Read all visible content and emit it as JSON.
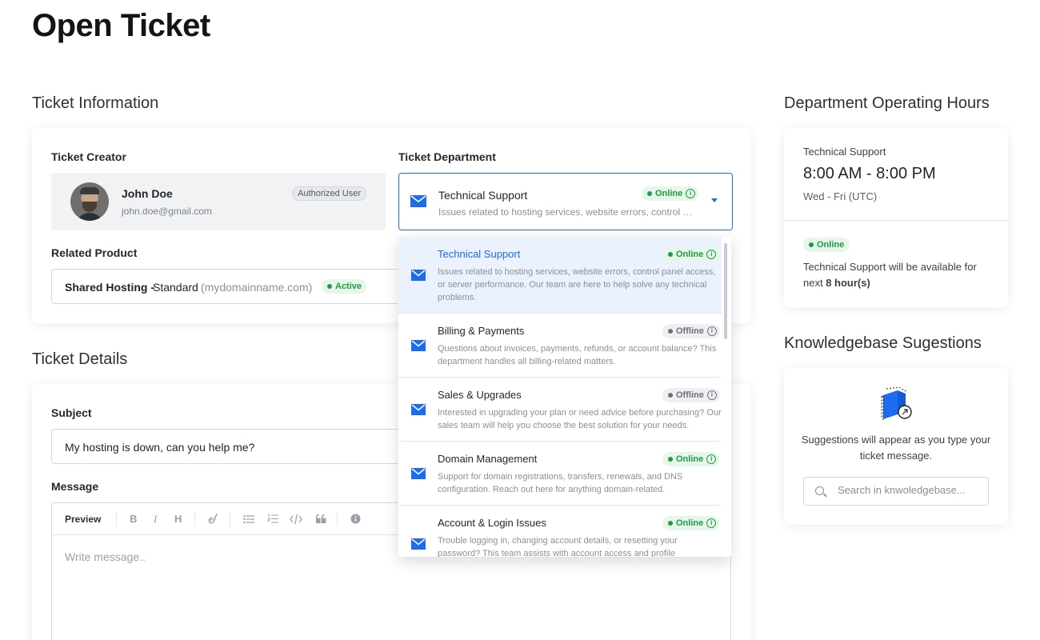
{
  "page": {
    "title": "Open Ticket"
  },
  "sections": {
    "ticket_information": "Ticket Information",
    "ticket_details": "Ticket Details",
    "operating_hours": "Department Operating Hours",
    "kb_suggestions": "Knowledgebase Sugestions"
  },
  "ticket_info": {
    "creator_label": "Ticket Creator",
    "creator_name": "John Doe",
    "creator_email": "john.doe@gmail.com",
    "creator_badge": "Authorized User",
    "department_label": "Ticket Department",
    "selected_department": {
      "name": "Technical Support",
      "status": "Online",
      "description": "Issues related to hosting services, website errors, control panel access, or server performance."
    },
    "product_label": "Related Product",
    "product": {
      "name": "Shared Hosting -",
      "plan": "Standard",
      "domain": "(mydomainname.com)",
      "status": "Active"
    }
  },
  "ticket_details": {
    "subject_label": "Subject",
    "subject_value": "My hosting is down, can you help me?",
    "message_label": "Message",
    "toolbar": {
      "preview": "Preview",
      "bold": "B",
      "italic": "I",
      "heading": "H"
    },
    "message_placeholder": "Write message.."
  },
  "departments": [
    {
      "name": "Technical Support",
      "status": "Online",
      "description": "Issues related to hosting services, website errors, control panel access, or server performance. Our team are here to help solve any technical problems."
    },
    {
      "name": "Billing & Payments",
      "status": "Offline",
      "description": "Questions about invoices, payments, refunds, or account balance? This department handles all billing-related matters."
    },
    {
      "name": "Sales & Upgrades",
      "status": "Offline",
      "description": "Interested in upgrading your plan or need advice before purchasing? Our sales team will help you choose the best solution for your needs."
    },
    {
      "name": "Domain Management",
      "status": "Online",
      "description": "Support for domain registrations, transfers, renewals, and DNS configuration. Reach out here for anything domain-related."
    },
    {
      "name": "Account & Login Issues",
      "status": "Online",
      "description": "Trouble logging in, changing account details, or resetting your password? This team assists with account access and profile"
    }
  ],
  "hours": {
    "department": "Technical Support",
    "time": "8:00 AM - 8:00 PM",
    "days": "Wed - Fri (UTC)",
    "status": "Online",
    "availability_prefix": "Technical Support will be available for next ",
    "availability_hours": "8 hour(s)"
  },
  "kb": {
    "text": "Suggestions will appear as you type your ticket message.",
    "search_placeholder": "Search in knwoledgebase..."
  },
  "colors": {
    "accent": "#1c6bf0",
    "online": "#1f9a3f",
    "offline": "#6d7279"
  }
}
